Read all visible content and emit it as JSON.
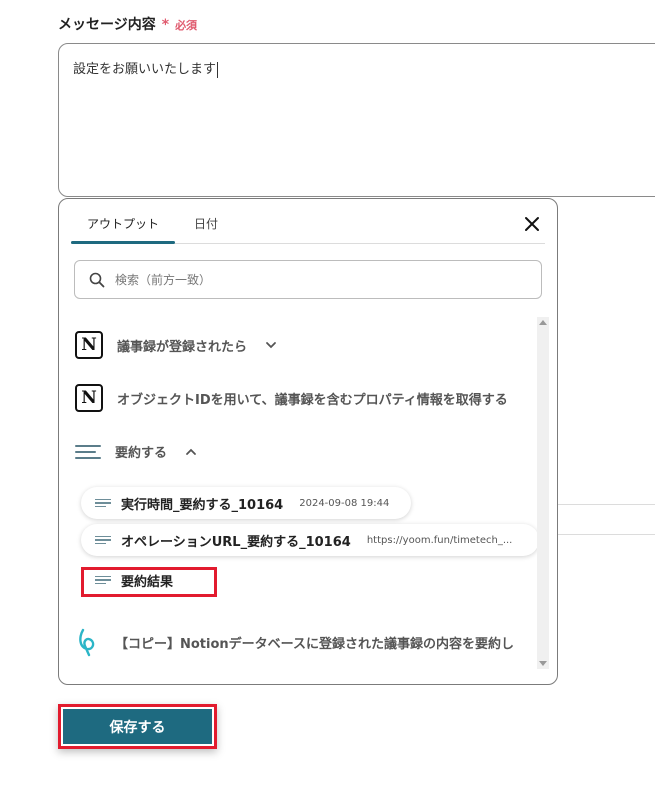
{
  "field": {
    "label": "メッセージ内容",
    "required_star": "*",
    "required_text": "必須",
    "value": "設定をお願いいたします"
  },
  "popup": {
    "tabs": [
      {
        "label": "アウトプット",
        "active": true
      },
      {
        "label": "日付",
        "active": false
      }
    ],
    "search_placeholder": "検索（前方一致）",
    "items": [
      {
        "icon": "notion-icon",
        "label": "議事録が登録されたら",
        "expand": "chevron-down"
      },
      {
        "icon": "notion-icon",
        "label": "オブジェクトIDを用いて、議事録を含むプロパティ情報を取得する"
      },
      {
        "icon": "lines-icon",
        "label": "要約する",
        "expand": "chevron-up"
      },
      {
        "icon": "yoom-icon",
        "label": "【コピー】Notionデータベースに登録された議事録の内容を要約し"
      }
    ],
    "outputs": [
      {
        "name": "実行時間_要約する_10164",
        "value": "2024-09-08 19:44"
      },
      {
        "name": "オペレーションURL_要約する_10164",
        "value": "https://yoom.fun/timetech_..."
      },
      {
        "name": "要約結果",
        "value": ""
      }
    ]
  },
  "save_button": {
    "label": "保存する"
  },
  "colors": {
    "accent": "#1e6a80",
    "highlight": "#e21b2e",
    "required": "#e05a6e"
  }
}
